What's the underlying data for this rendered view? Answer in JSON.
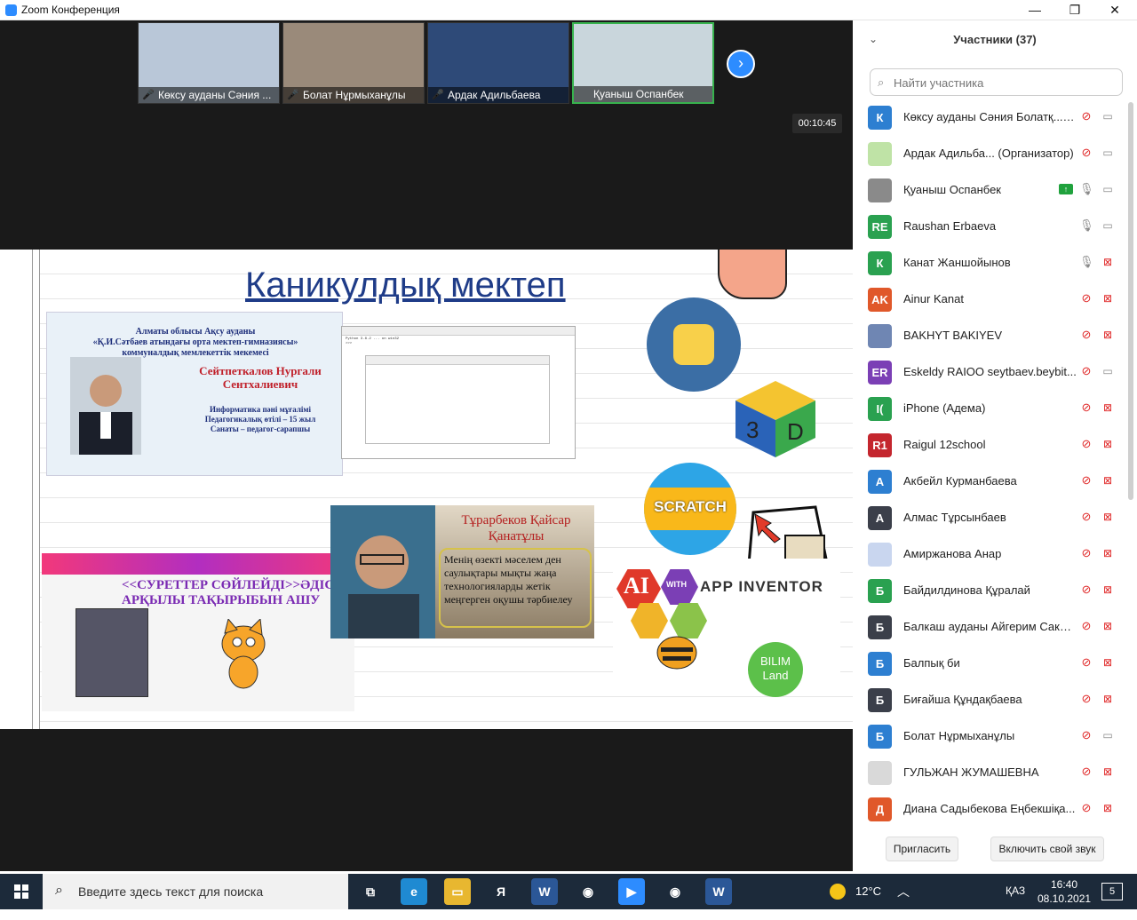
{
  "window": {
    "title": "Zoom Конференция",
    "minimize": "—",
    "restore": "❐",
    "close": "✕"
  },
  "thumbnails": [
    {
      "name": "Көксу ауданы Сәния ...",
      "active": false,
      "bg": "#b9c7d8"
    },
    {
      "name": "Болат Нұрмыханұлы",
      "active": false,
      "bg": "#9a8a7a"
    },
    {
      "name": "Ардак Адильбаева",
      "active": false,
      "bg": "#2e4a78"
    },
    {
      "name": "Қуаныш Оспанбек",
      "active": true,
      "bg": "#c9d6dc"
    }
  ],
  "next_icon": "›",
  "timer": "00:10:45",
  "slide": {
    "title": "Каникулдық мектеп",
    "card1": {
      "line1": "Алматы облысы Ақсу ауданы",
      "line2": "«Қ.И.Сәтбаев атындағы орта мектеп-гимназиясы»",
      "line3": "коммуналдық мемлекеттік мекемесі",
      "name": "Сейтпеткалов Нургали Сентхалиевич",
      "info1": "Информатика пәні мұғалімі",
      "info2": "Педагогикалық өтілі – 15 жыл",
      "info3": "Санаты – педагог-сарапшы"
    },
    "card4": {
      "heading1": "<<СУРЕТТЕР СӨЙЛЕЙДІ>>ӘДІС",
      "heading2": "АРҚЫЛЫ ТАҚЫРЫБЫН АШУ"
    },
    "card5": {
      "name": "Тұрарбеков Қайсар Қанатұлы",
      "text": "Менің өзекті мәселем ден саулықтары мықты жаңа технологияларды жетік меңгерген оқушы тәрбиелеу"
    },
    "scratch": "SCRATCH",
    "cube": "3D",
    "ai": {
      "ai": "AI",
      "with": "WITH",
      "label": "APP INVENTOR"
    },
    "bilim": "BILIM Land"
  },
  "panel": {
    "title": "Участники (37)",
    "search_placeholder": "Найти участника",
    "invite": "Пригласить",
    "unmute": "Включить свой звук",
    "participants": [
      {
        "initials": "К",
        "color": "#2d7fd1",
        "name": "Көксу ауданы Сәния Болатқ... (Я)",
        "mic": "off",
        "cam": "on"
      },
      {
        "initials": "",
        "color": "#bfe3a6",
        "name": "Ардак Адильба... (Организатор)",
        "mic": "off",
        "cam": "on"
      },
      {
        "initials": "",
        "color": "#8a8a8a",
        "name": "Қуаныш Оспанбек",
        "mic": "on",
        "cam": "on",
        "sharing": true
      },
      {
        "initials": "RE",
        "color": "#2aa150",
        "name": "Raushan Erbaeva",
        "mic": "on",
        "cam": "on"
      },
      {
        "initials": "К",
        "color": "#2aa150",
        "name": "Канат Жаншойынов",
        "mic": "on",
        "cam": "off"
      },
      {
        "initials": "AK",
        "color": "#e0582a",
        "name": "Ainur Kanat",
        "mic": "off",
        "cam": "off"
      },
      {
        "initials": "",
        "color": "#6f86b3",
        "name": "BAKHYT BAKIYEV",
        "mic": "off",
        "cam": "off"
      },
      {
        "initials": "ER",
        "color": "#7b3fb5",
        "name": "Eskeldy RAIOO seytbaev.beybit...",
        "mic": "off",
        "cam": "on"
      },
      {
        "initials": "I(",
        "color": "#2aa150",
        "name": "iPhone (Адема)",
        "mic": "off",
        "cam": "off"
      },
      {
        "initials": "R1",
        "color": "#c4262e",
        "name": "Raigul 12school",
        "mic": "off",
        "cam": "off"
      },
      {
        "initials": "А",
        "color": "#2d7fd1",
        "name": "Акбейл Курманбаева",
        "mic": "off",
        "cam": "off"
      },
      {
        "initials": "А",
        "color": "#3b3f4a",
        "name": "Алмас Тұрсынбаев",
        "mic": "off",
        "cam": "off"
      },
      {
        "initials": "",
        "color": "#c9d6ef",
        "name": "Амиржанова Анар",
        "mic": "off",
        "cam": "off"
      },
      {
        "initials": "Б",
        "color": "#2aa150",
        "name": "Байдилдинова Құралай",
        "mic": "off",
        "cam": "off"
      },
      {
        "initials": "Б",
        "color": "#3b3f4a",
        "name": "Балкаш ауданы Айгерим Сакен...",
        "mic": "off",
        "cam": "off"
      },
      {
        "initials": "Б",
        "color": "#2d7fd1",
        "name": "Балпық би",
        "mic": "off",
        "cam": "off"
      },
      {
        "initials": "Б",
        "color": "#3b3f4a",
        "name": "Биғайша Құндақбаева",
        "mic": "off",
        "cam": "off"
      },
      {
        "initials": "Б",
        "color": "#2d7fd1",
        "name": "Болат Нұрмыханұлы",
        "mic": "off",
        "cam": "on"
      },
      {
        "initials": "",
        "color": "#d9d9d9",
        "name": "ГУЛЬЖАН ЖУМАШЕВНА",
        "mic": "off",
        "cam": "off"
      },
      {
        "initials": "Д",
        "color": "#e0582a",
        "name": "Диана Садыбекова Еңбекшіқа...",
        "mic": "off",
        "cam": "off"
      }
    ]
  },
  "taskbar": {
    "search_placeholder": "Введите здесь текст для поиска",
    "apps": [
      {
        "name": "task-view-icon",
        "glyph": "⧉",
        "bg": "transparent"
      },
      {
        "name": "edge-icon",
        "glyph": "e",
        "bg": "#1f8ad2"
      },
      {
        "name": "file-explorer-icon",
        "glyph": "▭",
        "bg": "#e8b730"
      },
      {
        "name": "yandex-icon",
        "glyph": "Я",
        "bg": "transparent"
      },
      {
        "name": "word-icon",
        "glyph": "W",
        "bg": "#2b5797"
      },
      {
        "name": "chrome-icon",
        "glyph": "◉",
        "bg": "transparent"
      },
      {
        "name": "zoom-icon",
        "glyph": "▶",
        "bg": "#2d8cff"
      },
      {
        "name": "chrome-alt-icon",
        "glyph": "◉",
        "bg": "transparent"
      },
      {
        "name": "word-doc-icon",
        "glyph": "W",
        "bg": "#2b5797"
      }
    ],
    "weather": "12°C",
    "lang": "ҚАЗ",
    "time": "16:40",
    "date": "08.10.2021",
    "notifications": "5"
  }
}
